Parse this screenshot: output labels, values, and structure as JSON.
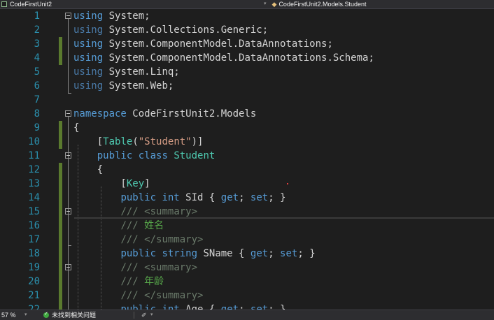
{
  "nav": {
    "project_label": "CodeFirstUnit2",
    "dropdown_symbol": "▾",
    "class_label": "CodeFirstUnit2.Models.Student"
  },
  "editor": {
    "lines": [
      {
        "num": "1"
      },
      {
        "num": "2"
      },
      {
        "num": "3"
      },
      {
        "num": "4"
      },
      {
        "num": "5"
      },
      {
        "num": "6"
      },
      {
        "num": "7"
      },
      {
        "num": "8"
      },
      {
        "num": "9"
      },
      {
        "num": "10"
      },
      {
        "num": "11"
      },
      {
        "num": "12"
      },
      {
        "num": "13"
      },
      {
        "num": "14"
      },
      {
        "num": "15"
      },
      {
        "num": "16"
      },
      {
        "num": "17"
      },
      {
        "num": "18"
      },
      {
        "num": "19"
      },
      {
        "num": "20"
      },
      {
        "num": "21"
      },
      {
        "num": "22"
      }
    ]
  },
  "status": {
    "zoom": "57 %",
    "zoom_dropdown": "▾",
    "issues": "未找到相关问题",
    "brush_icon_glyph": "✐",
    "brush_dropdown": "▾"
  },
  "colors": {
    "background": "#1e1e1e",
    "line_number": "#2b91af",
    "keyword": "#569cd6",
    "type": "#4ec9b0",
    "string": "#d69d85",
    "comment": "#57a64a",
    "change_marker": "#5a7a2e"
  },
  "icons": {
    "project": "csharp-project-icon",
    "class": "class-icon",
    "status_ok": "check-circle-icon",
    "brush": "brush-icon"
  }
}
